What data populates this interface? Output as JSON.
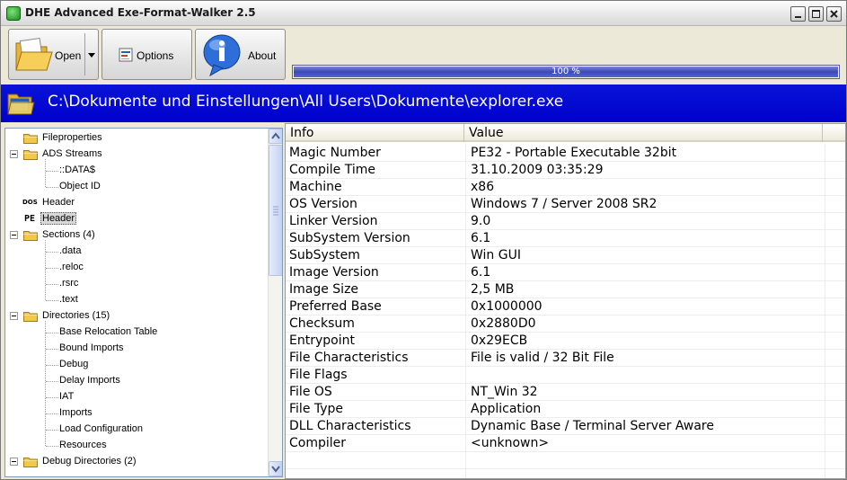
{
  "window": {
    "title": "DHE Advanced Exe-Format-Walker 2.5"
  },
  "toolbar": {
    "open_label": "Open",
    "options_label": "Options",
    "about_label": "About",
    "progress_percent": 100,
    "progress_text": "100 %"
  },
  "path": {
    "text": "C:\\Dokumente und Einstellungen\\All Users\\Dokumente\\explorer.exe"
  },
  "tree": {
    "items": [
      {
        "label": "Fileproperties"
      },
      {
        "label": "ADS Streams"
      },
      {
        "label": "::DATA$"
      },
      {
        "label": "Object ID"
      },
      {
        "label": "Header",
        "mark": "DOS"
      },
      {
        "label": "Header",
        "mark": "PE"
      },
      {
        "label": "Sections (4)"
      },
      {
        "label": ".data"
      },
      {
        "label": ".reloc"
      },
      {
        "label": ".rsrc"
      },
      {
        "label": ".text"
      },
      {
        "label": "Directories (15)"
      },
      {
        "label": "Base Relocation Table"
      },
      {
        "label": "Bound Imports"
      },
      {
        "label": "Debug"
      },
      {
        "label": "Delay Imports"
      },
      {
        "label": "IAT"
      },
      {
        "label": "Imports"
      },
      {
        "label": "Load Configuration"
      },
      {
        "label": "Resources"
      },
      {
        "label": "Debug Directories (2)"
      }
    ]
  },
  "table": {
    "col_info": "Info",
    "col_value": "Value",
    "rows": [
      {
        "info": "Magic Number",
        "value": "PE32 - Portable Executable 32bit"
      },
      {
        "info": "Compile Time",
        "value": "31.10.2009 03:35:29"
      },
      {
        "info": "Machine",
        "value": "x86"
      },
      {
        "info": "OS Version",
        "value": "Windows 7 / Server 2008 SR2"
      },
      {
        "info": "Linker Version",
        "value": "9.0"
      },
      {
        "info": "SubSystem Version",
        "value": "6.1"
      },
      {
        "info": "SubSystem",
        "value": "Win GUI"
      },
      {
        "info": "Image Version",
        "value": "6.1"
      },
      {
        "info": "Image Size",
        "value": "2,5 MB"
      },
      {
        "info": "Preferred Base",
        "value": "0x1000000"
      },
      {
        "info": "Checksum",
        "value": "0x2880D0"
      },
      {
        "info": "Entrypoint",
        "value": "0x29ECB"
      },
      {
        "info": "File Characteristics",
        "value": "File is valid / 32 Bit File"
      },
      {
        "info": "File Flags",
        "value": ""
      },
      {
        "info": "File OS",
        "value": "NT_Win 32"
      },
      {
        "info": "File Type",
        "value": "Application"
      },
      {
        "info": "DLL Characteristics",
        "value": "Dynamic Base / Terminal Server Aware"
      },
      {
        "info": "Compiler",
        "value": "<unknown>"
      }
    ]
  },
  "colors": {
    "path_bar": "#0000cc",
    "progress": "#3d48b8",
    "folder": "#f2c84b"
  }
}
